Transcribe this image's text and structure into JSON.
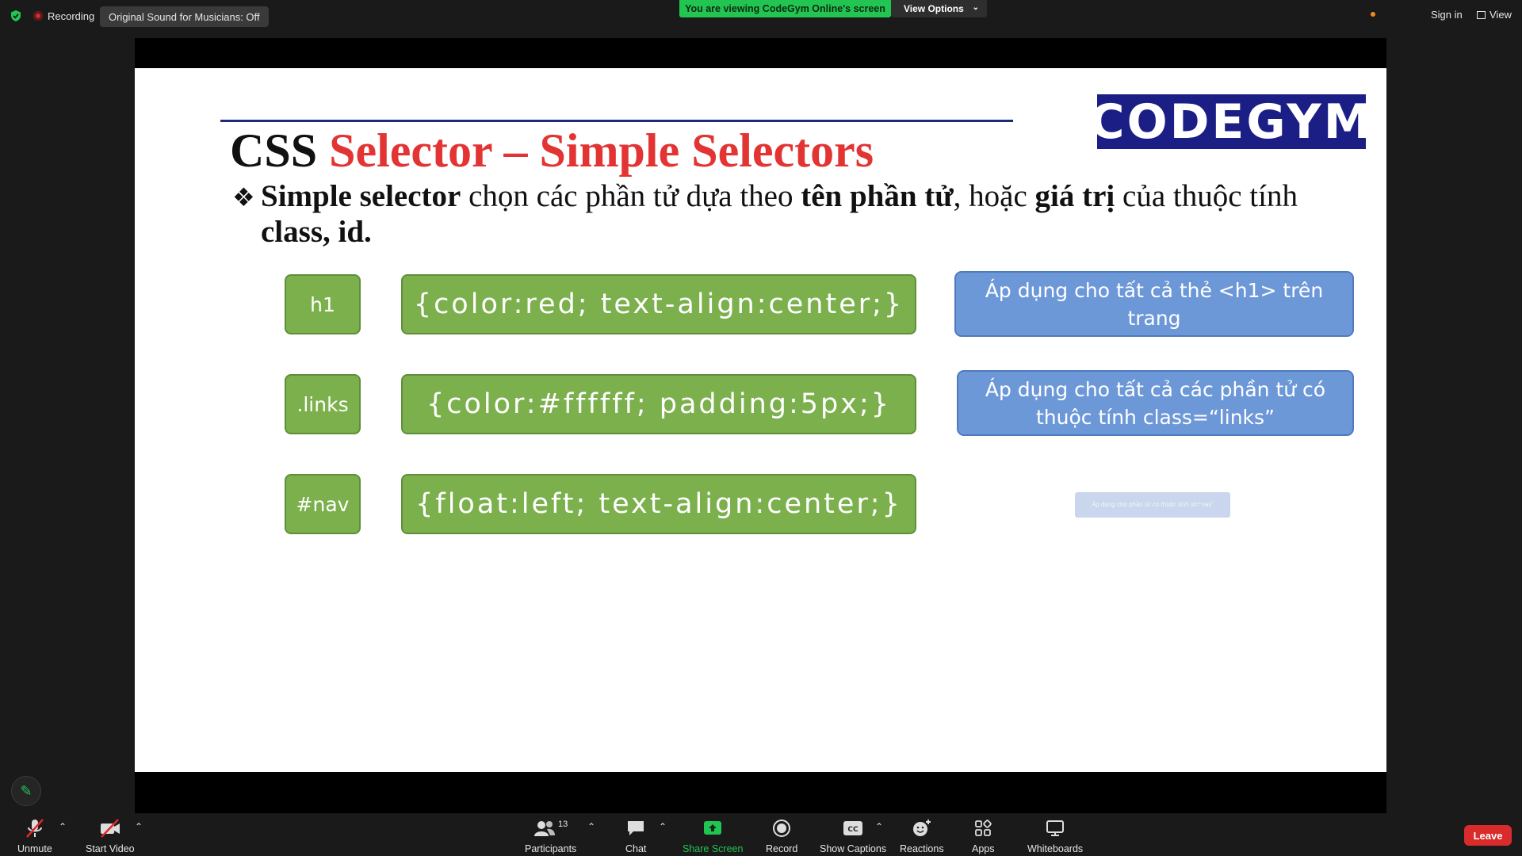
{
  "topbar": {
    "recording_label": "Recording",
    "sound_label": "Original Sound for Musicians: Off",
    "viewing_label": "You are viewing CodeGym Online's screen",
    "view_options_label": "View Options",
    "sign_in_label": "Sign in",
    "view_label": "View"
  },
  "slide": {
    "logo_text": "CODEGYM",
    "title_black": "CSS ",
    "title_red": "Selector – Simple Selectors",
    "bullet": {
      "p1": "Simple selector",
      "p2": " chọn các phần tử dựa theo ",
      "p3": "tên phần tử",
      "p4": ", hoặc ",
      "p5": "giá trị",
      "p6": " của thuộc tính ",
      "p7": "class, id."
    },
    "rows": [
      {
        "selector": "h1",
        "code": "{color:red; text-align:center;}",
        "desc": "Áp dụng cho tất cả thẻ <h1> trên trang"
      },
      {
        "selector": ".links",
        "code": "{color:#ffffff; padding:5px;}",
        "desc": "Áp dụng cho tất cả các phần tử có thuộc tính class=“links”"
      },
      {
        "selector": "#nav",
        "code": "{float:left; text-align:center;}",
        "desc": "Áp dụng cho phần tử có thuộc tính id=“nav”"
      }
    ]
  },
  "toolbar": {
    "unmute_label": "Unmute",
    "start_video_label": "Start Video",
    "participants_label": "Participants",
    "participants_count": "13",
    "chat_label": "Chat",
    "share_screen_label": "Share Screen",
    "record_label": "Record",
    "show_captions_label": "Show Captions",
    "reactions_label": "Reactions",
    "apps_label": "Apps",
    "whiteboards_label": "Whiteboards",
    "leave_label": "Leave"
  },
  "colors": {
    "green_accent": "#23c552",
    "leave_red": "#d92b2b",
    "slide_green_box": "#7bb04c",
    "slide_blue_box": "#6d98d8",
    "title_red": "#e33434",
    "logo_bg": "#1b1f85"
  }
}
